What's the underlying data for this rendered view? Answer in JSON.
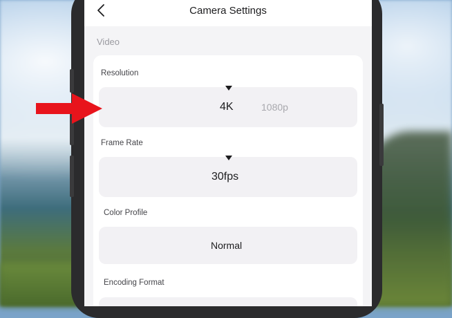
{
  "header": {
    "title": "Camera Settings"
  },
  "section": {
    "label": "Video"
  },
  "settings": {
    "resolution": {
      "label": "Resolution",
      "value": "4K",
      "alternative": "1080p"
    },
    "frame_rate": {
      "label": "Frame Rate",
      "value": "30fps"
    },
    "color_profile": {
      "label": "Color Profile",
      "value": "Normal"
    },
    "encoding_format": {
      "label": "Encoding Format"
    }
  },
  "colors": {
    "accent_arrow": "#e8141c",
    "screen_bg": "#f4f4f6",
    "picker_bg": "#f2f1f4"
  },
  "icons": {
    "back": "chevron-left-icon",
    "selector": "triangle-down-icon",
    "pointer": "red-arrow-icon"
  }
}
